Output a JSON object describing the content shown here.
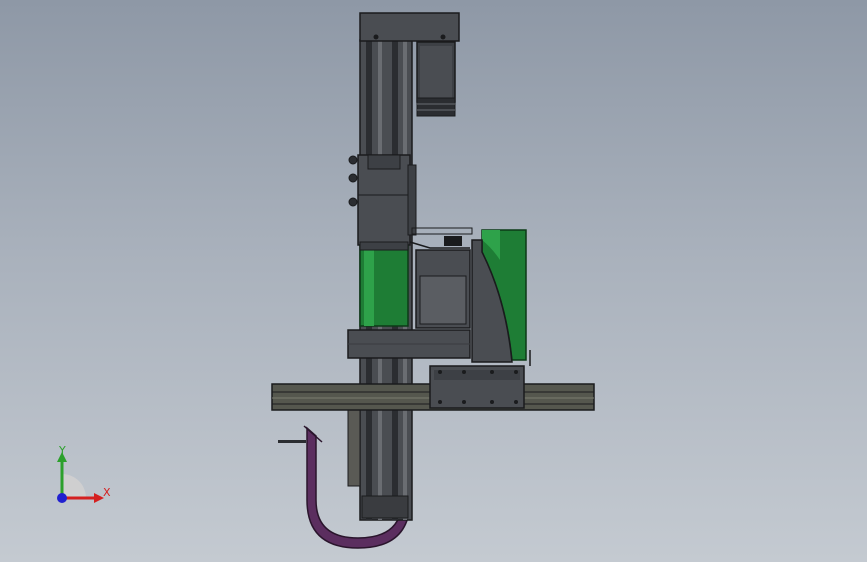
{
  "viewport": {
    "background_top": "#8e98a6",
    "background_bottom": "#c4cad1"
  },
  "model": {
    "parts": [
      "vertical-column",
      "top-cap-plate",
      "servo-motor",
      "carriage-block",
      "green-motor-cylinder",
      "gearbox",
      "green-guard-plate",
      "mount-plate",
      "horizontal-rail",
      "rail-carriage",
      "cable-chain"
    ],
    "colors": {
      "body": "#4a4d52",
      "dark": "#2b2d31",
      "edge": "#1a1b1d",
      "green": "#1e7d35",
      "green_light": "#2ea24a",
      "purple": "#5b2e5f",
      "rail": "#55574e"
    }
  },
  "triad": {
    "x_label": "X",
    "y_label": "Y",
    "x_color": "#d42020",
    "y_color": "#2ca02c",
    "z_color": "#2020d0"
  }
}
